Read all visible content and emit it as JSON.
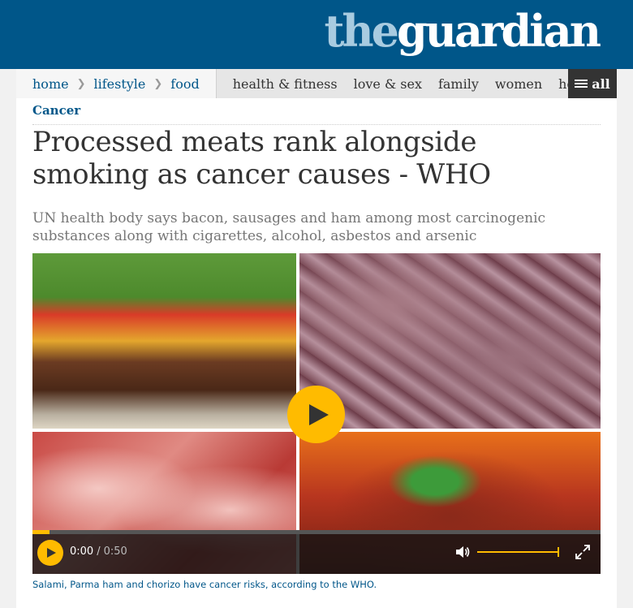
{
  "masthead": {
    "logo_the": "the",
    "logo_guardian": "guardian"
  },
  "nav": {
    "breadcrumbs": [
      "home",
      "lifestyle",
      "food"
    ],
    "sections": [
      "health & fitness",
      "love & sex",
      "family",
      "women",
      "home & ga"
    ],
    "all_label": "all"
  },
  "article": {
    "kicker": "Cancer",
    "headline": "Processed meats rank alongside smoking as cancer causes - WHO",
    "standfirst": "UN health body says bacon, sausages and ham among most carcinogenic substances along with cigarettes, alcohol, asbestos and arsenic",
    "caption": "Salami, Parma ham and chorizo have cancer risks, according to the WHO."
  },
  "video": {
    "current_time": "0:00",
    "separator": "/",
    "duration": "0:50",
    "progress_fraction": 0.03,
    "volume_fraction": 1.0
  },
  "colors": {
    "brand_blue": "#005689",
    "accent_yellow": "#ffbb00"
  },
  "icons": [
    "menu-icon",
    "play-icon",
    "volume-icon",
    "fullscreen-icon",
    "chevron-right-icon"
  ]
}
